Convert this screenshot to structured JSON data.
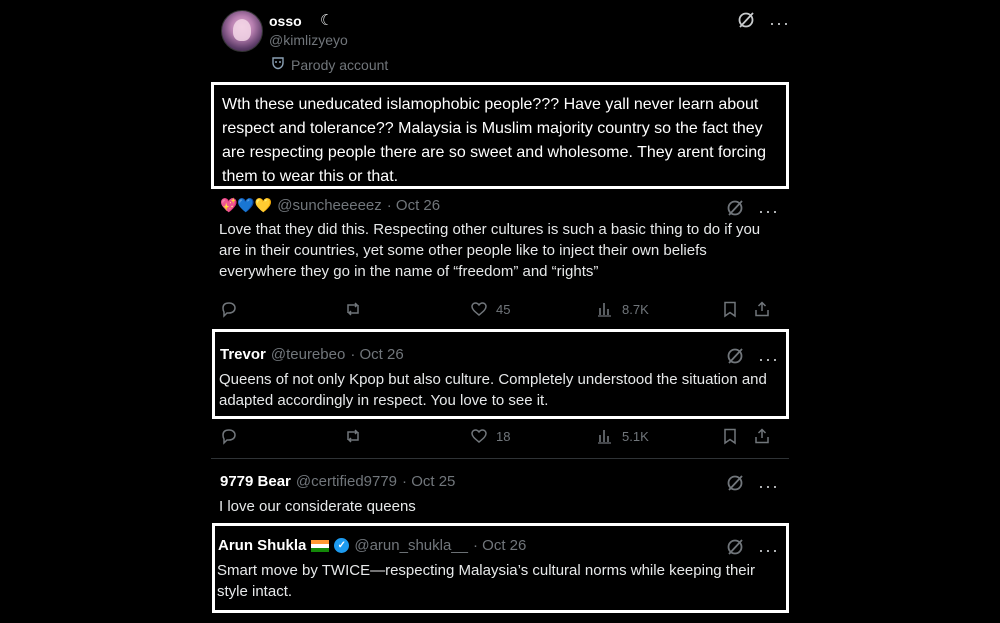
{
  "post": {
    "display_name": "osso",
    "name_emoji": "☾",
    "handle": "@kimlizyeyo",
    "badge_icon": "mask-icon",
    "badge_label": "Parody account",
    "text": "Wth these uneducated islamophobic people??? Have yall never learn about respect and tolerance?? Malaysia is Muslim majority country so the fact they are respecting people there are so sweet and wholesome. They arent forcing them to wear this or that."
  },
  "replies": [
    {
      "name_emojis": "💖💙💛",
      "handle": "@suncheeeeez",
      "date": "· Oct 26",
      "text": "Love that they did this. Respecting other cultures is such a basic thing to do if you are in their countries, yet some other people like to inject their own beliefs everywhere they go in the name of “freedom” and “rights”",
      "likes": "45",
      "views": "8.7K"
    },
    {
      "name": "Trevor",
      "handle": "@teurebeo",
      "date": "· Oct 26",
      "text": "Queens of not only Kpop but also culture. Completely understood the situation and adapted accordingly in respect. You love to see it.",
      "likes": "18",
      "views": "5.1K"
    },
    {
      "name": "9779 Bear",
      "handle": "@certified9779",
      "date": "· Oct 25",
      "text": "I love our considerate queens"
    },
    {
      "name": "Arun Shukla",
      "handle": "@arun_shukla__",
      "date": "· Oct 26",
      "text": "Smart move by TWICE—respecting Malaysia’s cultural norms while keeping their style intact."
    }
  ],
  "colors": {
    "background": "#000000",
    "text": "#e7e9ea",
    "muted": "#71767b",
    "verified": "#1d9bf0",
    "highlight_border": "#ffffff"
  }
}
